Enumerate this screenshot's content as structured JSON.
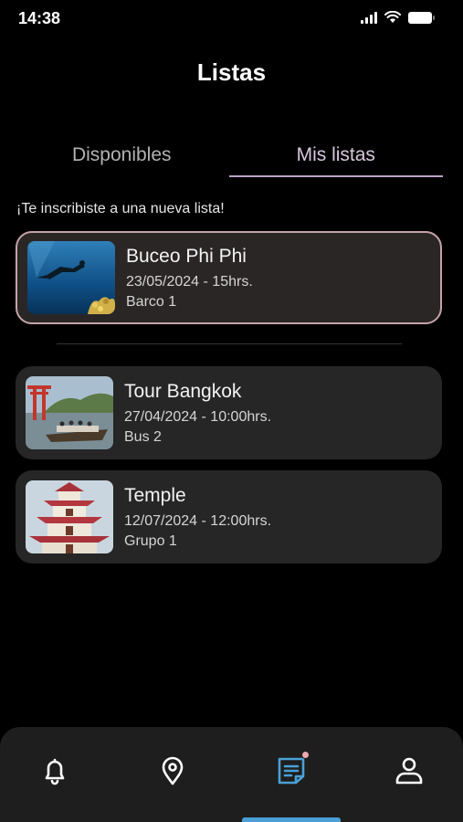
{
  "status_bar": {
    "time": "14:38"
  },
  "header": {
    "title": "Listas"
  },
  "tabs": [
    {
      "label": "Disponibles",
      "active": false
    },
    {
      "label": "Mis listas",
      "active": true
    }
  ],
  "notice": "¡Te inscribiste a una nueva lista!",
  "new_list": {
    "title": "Buceo Phi Phi",
    "date": "23/05/2024 - 15hrs.",
    "group": "Barco 1",
    "image": "diver-underwater-photo"
  },
  "lists": [
    {
      "title": "Tour Bangkok",
      "date": "27/04/2024 - 10:00hrs.",
      "group": "Bus 2",
      "image": "river-boat-torii-photo"
    },
    {
      "title": "Temple",
      "date": "12/07/2024 - 12:00hrs.",
      "group": "Grupo 1",
      "image": "pagoda-photo"
    }
  ],
  "nav": {
    "items": [
      "bell-icon",
      "location-pin-icon",
      "list-document-icon",
      "profile-icon"
    ],
    "active_index": 2,
    "accent_color": "#4aa0d6",
    "badge_color": "#f0a7b2"
  },
  "colors": {
    "highlight_border": "#c6a3a8",
    "tab_active_underline": "#b9a2c3"
  }
}
